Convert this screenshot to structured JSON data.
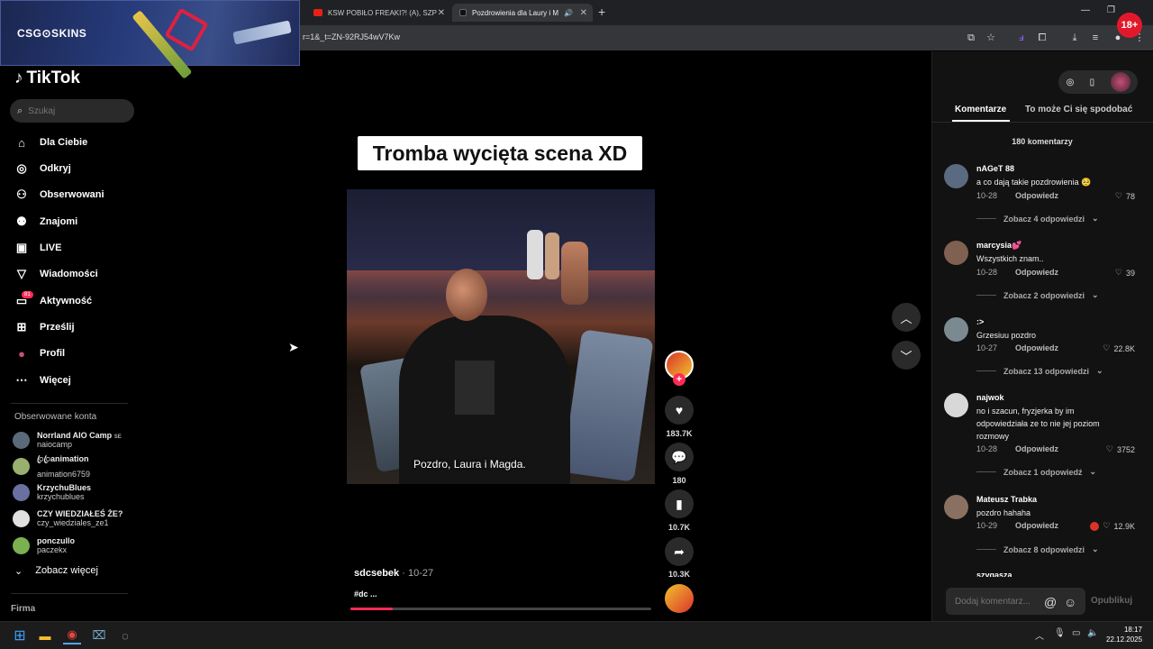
{
  "browser": {
    "tabs": [
      {
        "label": "KSW POBIŁO FREAKI?! (A), SZP"
      },
      {
        "label": "Pozdrowienia dla Laury i M"
      }
    ],
    "url": "r=1&_t=ZN-92RJ54wV7Kw",
    "age_badge": "18+"
  },
  "ad": {
    "brand": "CSG⊙SKINS"
  },
  "sidebar": {
    "logo": "TikTok",
    "search_placeholder": "Szukaj",
    "nav": [
      {
        "label": "Dla Ciebie",
        "icon": "home-icon"
      },
      {
        "label": "Odkryj",
        "icon": "compass-icon"
      },
      {
        "label": "Obserwowani",
        "icon": "following-icon"
      },
      {
        "label": "Znajomi",
        "icon": "friends-icon"
      },
      {
        "label": "LIVE",
        "icon": "live-icon"
      },
      {
        "label": "Wiadomości",
        "icon": "messages-icon"
      },
      {
        "label": "Aktywność",
        "icon": "activity-icon"
      },
      {
        "label": "Prześlij",
        "icon": "upload-icon"
      },
      {
        "label": "Profil",
        "icon": "profile-icon"
      },
      {
        "label": "Więcej",
        "icon": "more-icon"
      }
    ],
    "activity_badge": "81",
    "following_title": "Obserwowane konta",
    "accounts": [
      {
        "name": "Norrland AIO Camp",
        "handle": "naiocamp",
        "extra": "SE",
        "color": "#5a6a7a"
      },
      {
        "name": "ꦿꦿanimation",
        "handle": "animation6759",
        "color": "#9ab070"
      },
      {
        "name": "KrzychuBlues",
        "handle": "krzychublues",
        "color": "#6a70a0"
      },
      {
        "name": "CZY WIEDZIAŁEŚ ŻE?",
        "handle": "czy_wiedziales_ze1",
        "color": "#e0e0e0"
      },
      {
        "name": "ponczullo",
        "handle": "paczekx",
        "color": "#7ab050"
      }
    ],
    "see_more": "Zobacz więcej",
    "company": "Firma"
  },
  "video": {
    "overlay_title": "Tromba wycięta scena XD",
    "caption": "Pozdro, Laura i Magda.",
    "author": "sdcsebek",
    "date": "10-27",
    "description": "#dc ...",
    "progress": 0.14,
    "likes": "183.7K",
    "comments": "180",
    "saves": "10.7K",
    "shares": "10.3K"
  },
  "comments_panel": {
    "tab_comments": "Komentarze",
    "tab_liked": "To może Ci się spodobać",
    "count_label": "180 komentarzy",
    "reply_label": "Odpowiedz",
    "comments": [
      {
        "user": "nAGeT 88",
        "text": "a co dają takie pozdrowienia 🥺",
        "date": "10-28",
        "likes": "78",
        "more": "Zobacz 4 odpowiedzi",
        "color": "#5a6a80"
      },
      {
        "user": "marcysia💕",
        "text": "Wszystkich znam..",
        "date": "10-28",
        "likes": "39",
        "more": "Zobacz 2 odpowiedzi",
        "color": "#806050"
      },
      {
        "user": ":>",
        "text": "Grzesiuu pozdro",
        "date": "10-27",
        "likes": "22.8K",
        "more": "Zobacz 13 odpowiedzi",
        "color": "#7a8a90"
      },
      {
        "user": "najwok",
        "text": "no i szacun, fryzjerka by im odpowiedziała ze to nie jej poziom rozmowy",
        "date": "10-28",
        "likes": "3752",
        "more": "Zobacz 1 odpowiedź",
        "color": "#d8d8d8"
      },
      {
        "user": "Mateusz Trabka",
        "text": "pozdro hahaha",
        "date": "10-29",
        "likes": "12.9K",
        "more": "Zobacz 8 odpowiedzi",
        "color": "#8a7060"
      }
    ],
    "partial_user": "szygasza",
    "input_placeholder": "Dodaj komentarz...",
    "publish": "Opublikuj"
  },
  "taskbar": {
    "time": "18:17",
    "date": "22.12.2025"
  }
}
